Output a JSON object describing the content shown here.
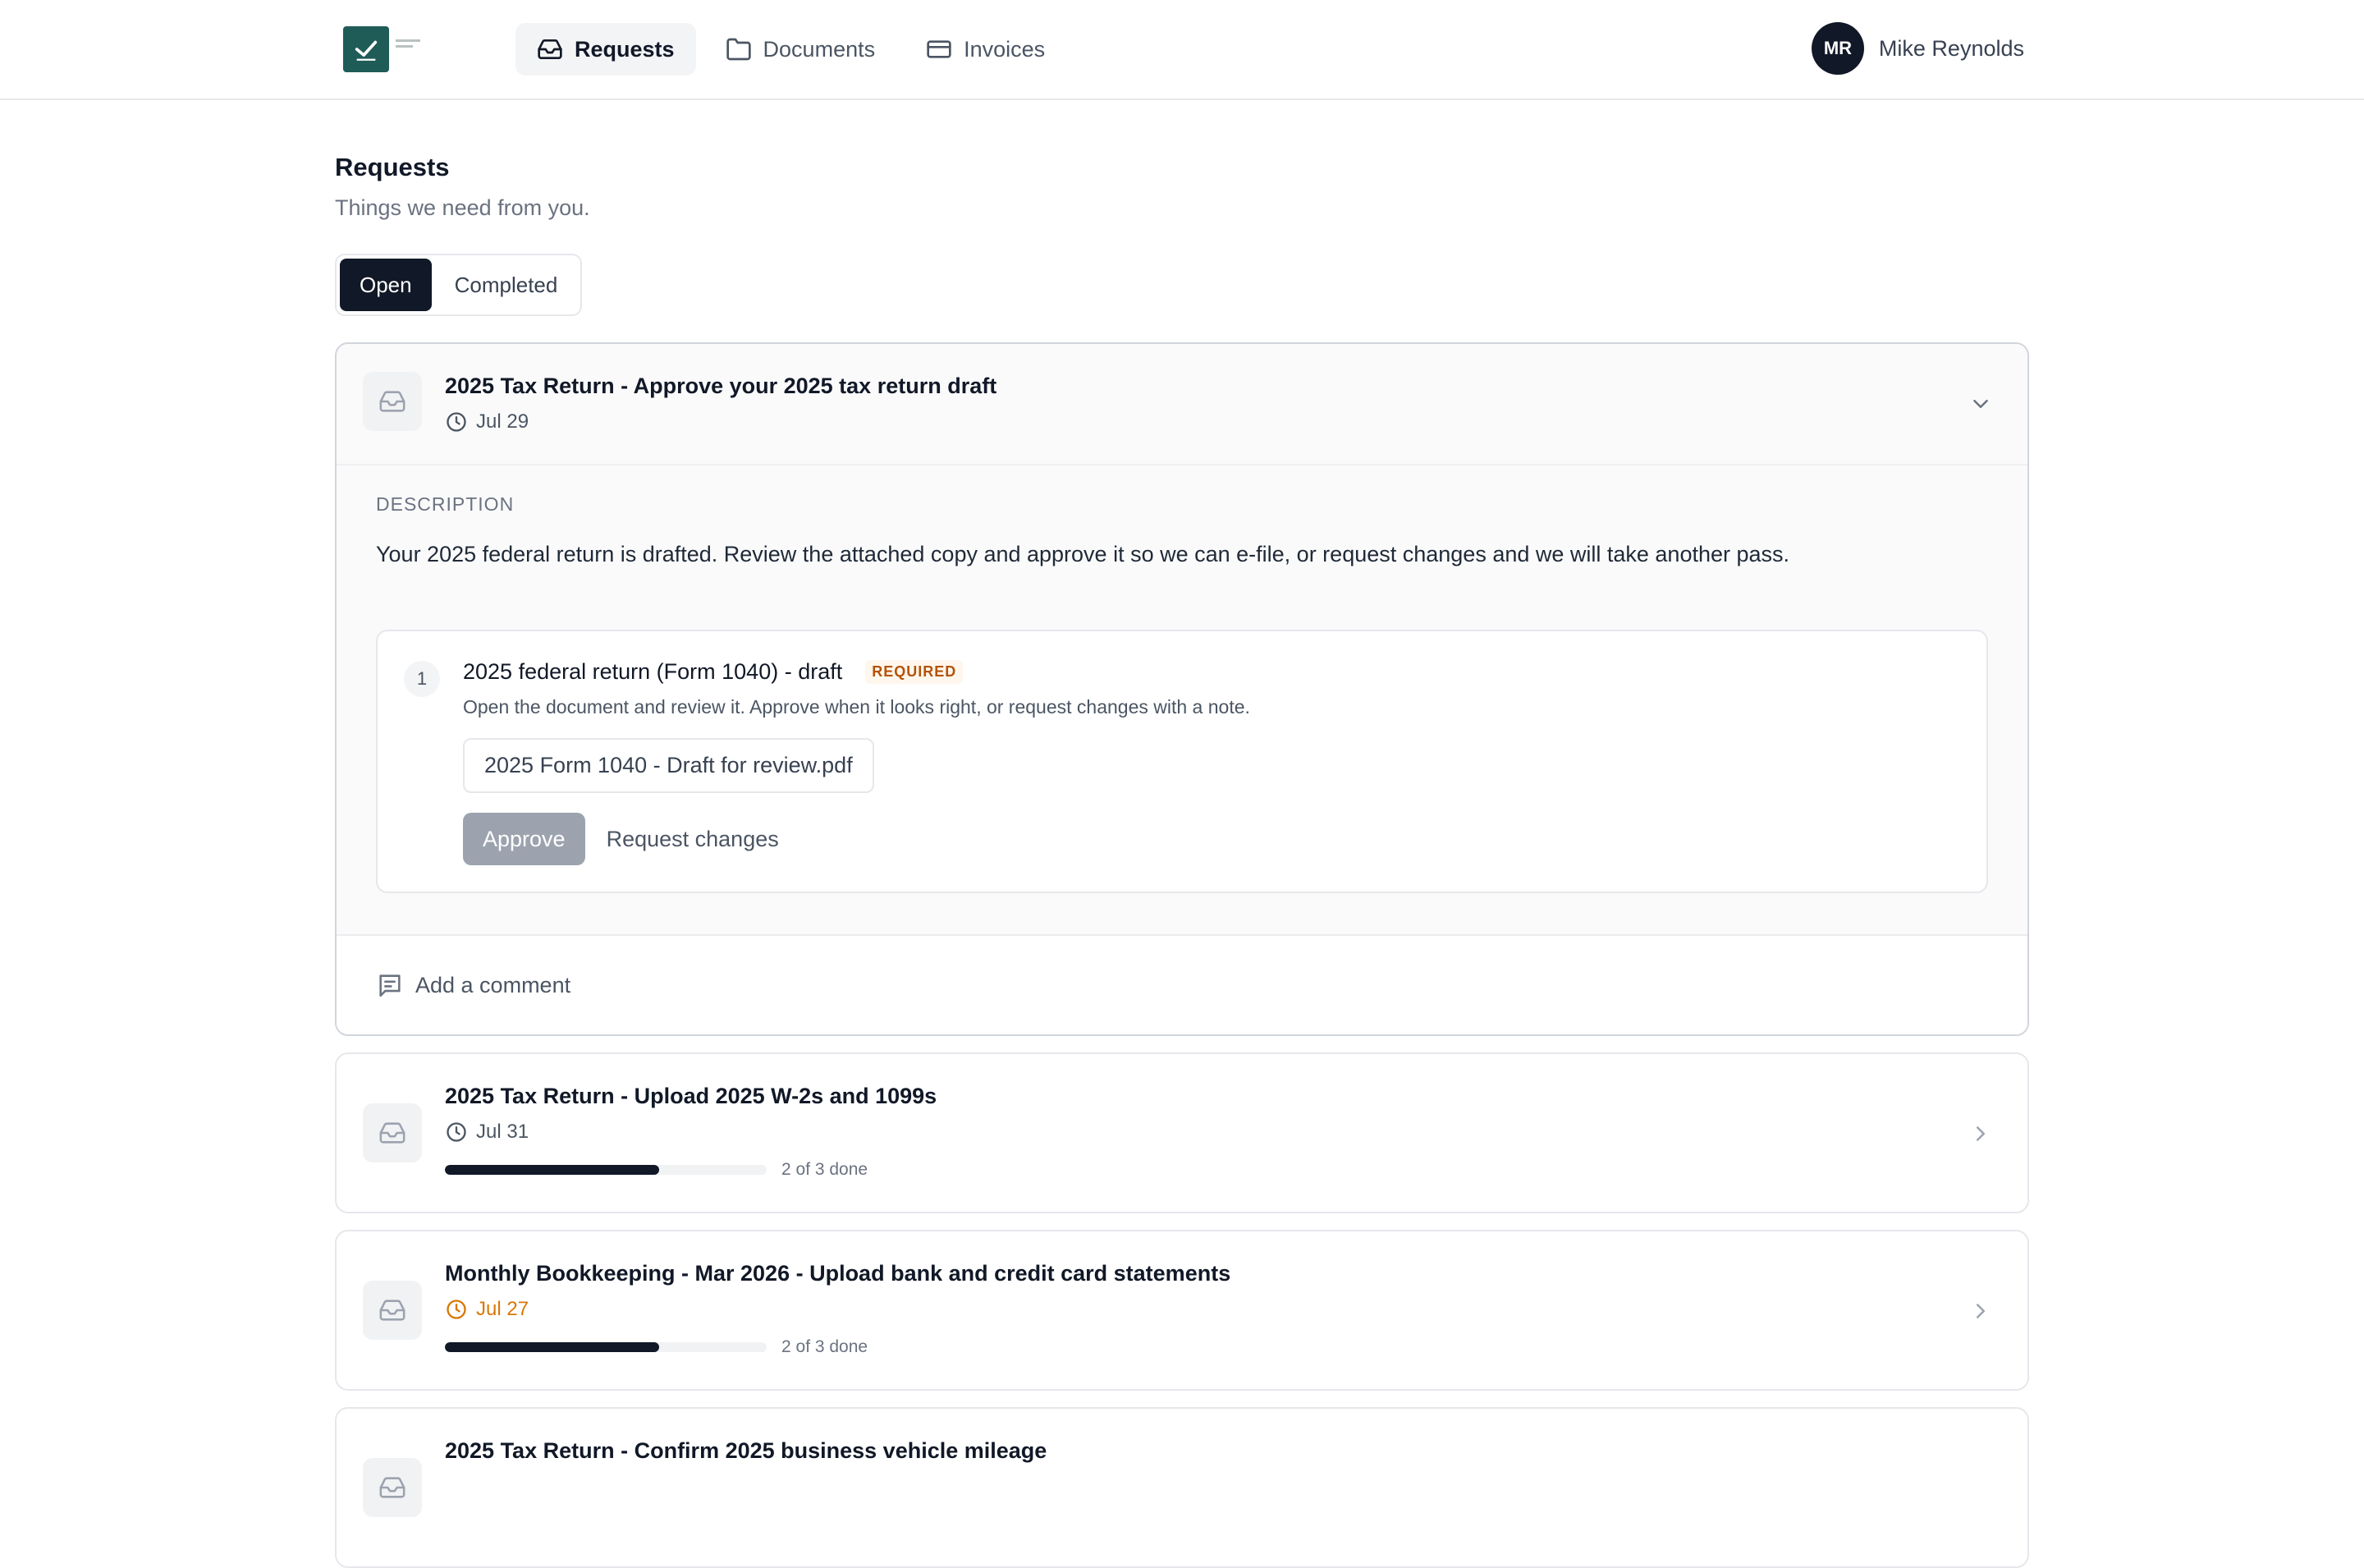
{
  "nav": {
    "items": [
      {
        "label": "Requests",
        "icon": "inbox-icon",
        "active": true
      },
      {
        "label": "Documents",
        "icon": "folder-icon",
        "active": false
      },
      {
        "label": "Invoices",
        "icon": "credit-card-icon",
        "active": false
      }
    ],
    "user": {
      "initials": "MR",
      "name": "Mike Reynolds"
    }
  },
  "page": {
    "title": "Requests",
    "subtitle": "Things we need from you."
  },
  "tabs": [
    {
      "label": "Open",
      "active": true
    },
    {
      "label": "Completed",
      "active": false
    }
  ],
  "expanded_request": {
    "title": "2025 Tax Return - Approve your 2025 tax return draft",
    "due": "Jul 29",
    "description_label": "Description",
    "description": "Your 2025 federal return is drafted. Review the attached copy and approve it so we can e-file, or request changes and we will take another pass.",
    "item": {
      "number": "1",
      "title": "2025 federal return (Form 1040) - draft",
      "badge": "REQUIRED",
      "note": "Open the document and review it. Approve when it looks right, or request changes with a note.",
      "file": "2025 Form 1040 - Draft for review.pdf",
      "approve_label": "Approve",
      "request_changes_label": "Request changes"
    },
    "comment_placeholder": "Add a comment"
  },
  "requests": [
    {
      "title": "2025 Tax Return - Upload 2025 W-2s and 1099s",
      "due": "Jul 31",
      "overdue": false,
      "progress": 0.667,
      "progress_label": "2 of 3 done"
    },
    {
      "title": "Monthly Bookkeeping - Mar 2026 - Upload bank and credit card statements",
      "due": "Jul 27",
      "overdue": true,
      "progress": 0.667,
      "progress_label": "2 of 3 done"
    },
    {
      "title": "2025 Tax Return - Confirm 2025 business vehicle mileage",
      "due": "",
      "overdue": false,
      "progress": null,
      "progress_label": ""
    }
  ],
  "colors": {
    "primary": "#111827",
    "brand": "#1f5c57",
    "warning": "#d97706",
    "badge": "#b45309",
    "disabled_button": "#9ca3af"
  }
}
